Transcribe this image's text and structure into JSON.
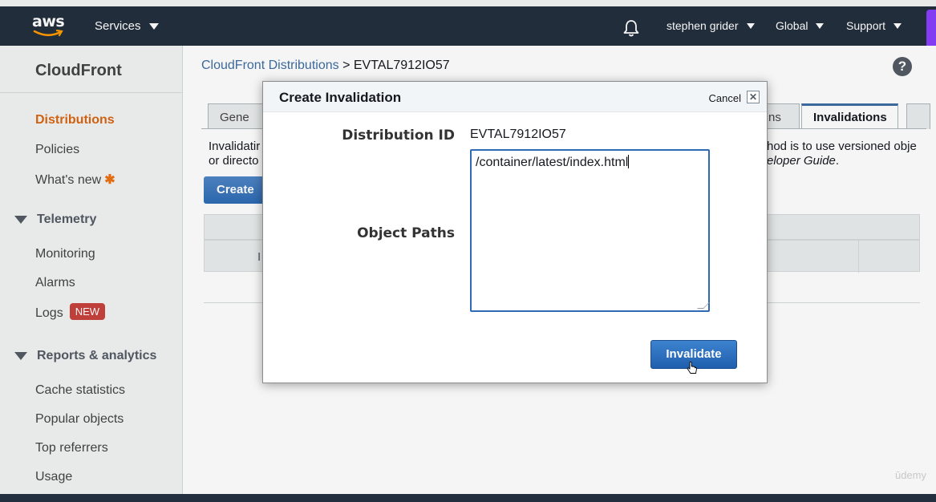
{
  "header": {
    "logo_text": "aws",
    "services_label": "Services",
    "user_label": "stephen grider",
    "region_label": "Global",
    "support_label": "Support"
  },
  "sidebar": {
    "title": "CloudFront",
    "items": [
      {
        "label": "Distributions",
        "active": true
      },
      {
        "label": "Policies"
      },
      {
        "label": "What's new"
      }
    ],
    "star": "✱",
    "telemetry": {
      "label": "Telemetry",
      "items": [
        "Monitoring",
        "Alarms",
        "Logs"
      ],
      "logs_badge": "NEW"
    },
    "reports": {
      "label": "Reports & analytics",
      "items": [
        "Cache statistics",
        "Popular objects",
        "Top referrers",
        "Usage"
      ]
    }
  },
  "main": {
    "breadcrumb_link": "CloudFront Distributions",
    "breadcrumb_sep": " > ",
    "breadcrumb_current": "EVTAL7912IO57",
    "tabs": [
      {
        "label": "Gene"
      },
      {
        "label": "ns"
      },
      {
        "label": "Invalidations",
        "active": true
      }
    ],
    "info_left_1": "Invalidatir",
    "info_left_2": "or directo",
    "info_right_1": "hod is to use versioned obje",
    "info_right_2": "eloper Guide",
    "info_right_2_end": ".",
    "create_button": "Create",
    "grid_fragment": "I"
  },
  "modal": {
    "title": "Create Invalidation",
    "cancel_label": "Cancel",
    "close_glyph": "✕",
    "distribution_id_label": "Distribution ID",
    "distribution_id_value": "EVTAL7912IO57",
    "object_paths_label": "Object Paths",
    "object_paths_value": "/container/latest/index.html",
    "invalidate_button": "Invalidate"
  },
  "watermark": "ūdemy",
  "colors": {
    "nav_bg": "#232f3e",
    "accent_orange": "#d86613",
    "link_blue": "#3f6ea2",
    "button_blue": "#2e6bb4",
    "badge_red": "#c7433d"
  }
}
